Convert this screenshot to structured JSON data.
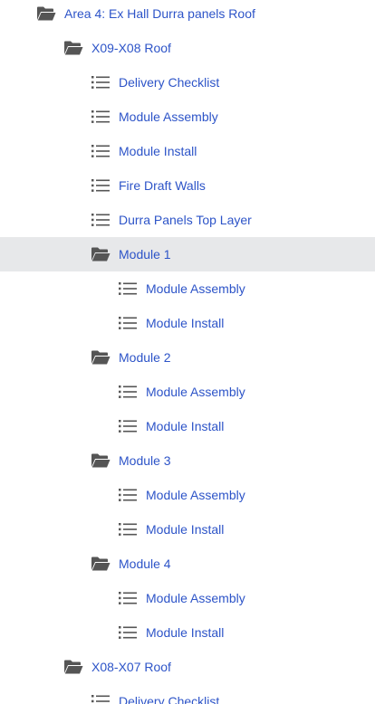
{
  "tree": {
    "nodes": [
      {
        "label": "Area 4: Ex Hall Durra panels Roof",
        "type": "folder",
        "level": 0
      },
      {
        "label": "X09-X08 Roof",
        "type": "folder",
        "level": 1
      },
      {
        "label": "Delivery Checklist",
        "type": "list",
        "level": 2
      },
      {
        "label": "Module Assembly",
        "type": "list",
        "level": 2
      },
      {
        "label": "Module Install",
        "type": "list",
        "level": 2
      },
      {
        "label": "Fire Draft Walls",
        "type": "list",
        "level": 2
      },
      {
        "label": "Durra Panels Top Layer",
        "type": "list",
        "level": 2
      },
      {
        "label": "Module 1",
        "type": "folder",
        "level": 2,
        "selected": true
      },
      {
        "label": "Module Assembly",
        "type": "list",
        "level": 3
      },
      {
        "label": "Module Install",
        "type": "list",
        "level": 3
      },
      {
        "label": "Module 2",
        "type": "folder",
        "level": 2
      },
      {
        "label": "Module Assembly",
        "type": "list",
        "level": 3
      },
      {
        "label": "Module Install",
        "type": "list",
        "level": 3
      },
      {
        "label": "Module 3",
        "type": "folder",
        "level": 2
      },
      {
        "label": "Module Assembly",
        "type": "list",
        "level": 3
      },
      {
        "label": "Module Install",
        "type": "list",
        "level": 3
      },
      {
        "label": "Module 4",
        "type": "folder",
        "level": 2
      },
      {
        "label": "Module Assembly",
        "type": "list",
        "level": 3
      },
      {
        "label": "Module Install",
        "type": "list",
        "level": 3
      },
      {
        "label": "X08-X07 Roof",
        "type": "folder",
        "level": 1
      },
      {
        "label": "Delivery Checklist",
        "type": "list",
        "level": 2
      }
    ]
  },
  "colors": {
    "link": "#2d54c8",
    "icon": "#555555",
    "selected_bg": "#e7e8ea"
  },
  "icons": {
    "folder": "folder-open-icon",
    "list": "list-icon"
  }
}
